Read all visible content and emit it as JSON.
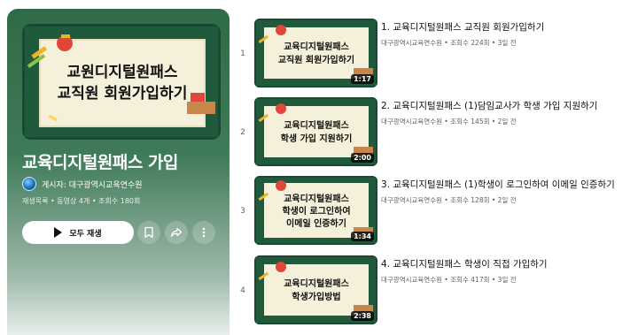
{
  "playlist": {
    "title": "교육디지털원패스 가입",
    "hero_lines": [
      "교원디지털원패스",
      "교직원 회원가입하기"
    ],
    "owner_label": "게시자: 대구광역시교육연수원",
    "meta": "재생목록 • 동영상 4개 • 조회수 180회",
    "play_all_label": "모두 재생"
  },
  "videos": [
    {
      "index": "1",
      "title": "1. 교육디지털원패스 교직원 회원가입하기",
      "meta": "대구광역시교육연수원 • 조회수 224회 • 3일 전",
      "duration": "1:17",
      "thumb_lines": [
        "교육디지털원패스",
        "교직원 회원가입하기"
      ]
    },
    {
      "index": "2",
      "title": "2. 교육디지털원패스 (1)담임교사가 학생 가입 지원하기",
      "meta": "대구광역시교육연수원 • 조회수 145회 • 2일 전",
      "duration": "2:00",
      "thumb_lines": [
        "교육디지털원패스",
        "학생 가입 지원하기"
      ]
    },
    {
      "index": "3",
      "title": "3. 교육디지털원패스 (1)학생이 로그인하여 이메일 인증하기",
      "meta": "대구광역시교육연수원 • 조회수 128회 • 2일 전",
      "duration": "1:34",
      "thumb_lines": [
        "교육디지털원패스",
        "학생이 로그인하여",
        "이메일 인증하기"
      ]
    },
    {
      "index": "4",
      "title": "4. 교육디지털원패스 학생이 직접 가입하기",
      "meta": "대구광역시교육연수원 • 조회수 417회 • 3일 전",
      "duration": "2:38",
      "thumb_lines": [
        "교육디지털원패스",
        "학생가입방법"
      ]
    }
  ],
  "colors": {
    "chalkboard": "#1f5a3c",
    "board_paper": "#f4f0da",
    "book_red": "#e0463a",
    "book_yellow": "#f0b429"
  },
  "icons": [
    "play-icon",
    "save-icon",
    "share-icon",
    "more-icon",
    "channel-avatar-icon"
  ]
}
